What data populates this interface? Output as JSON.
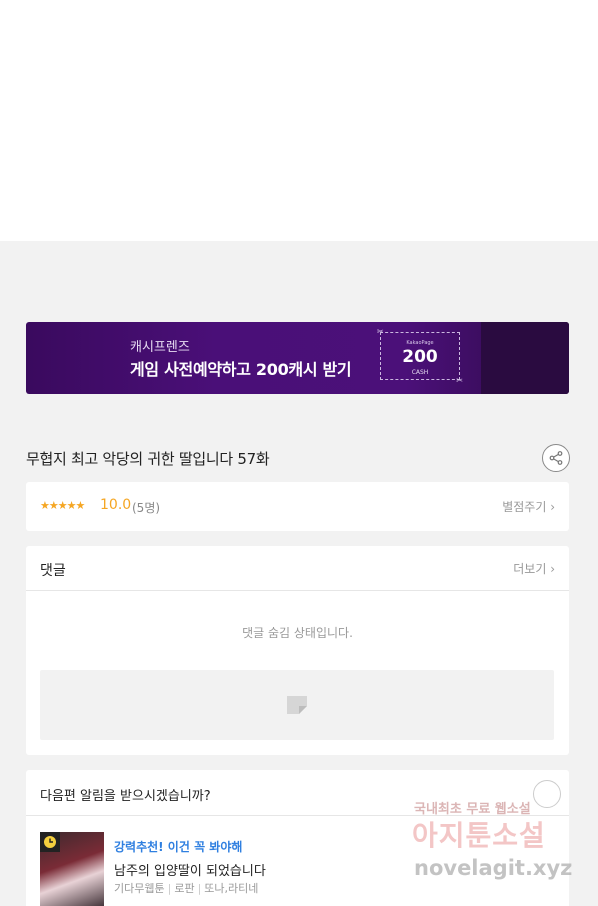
{
  "banner": {
    "subtitle": "캐시프렌즈",
    "title": "게임 사전예약하고 200캐시 받기",
    "coupon_brand": "KakaoPage",
    "coupon_amount": "200",
    "coupon_unit": "CASH"
  },
  "episode": {
    "title": "무협지 최고 악당의 귀한 딸입니다 57화"
  },
  "rating": {
    "stars": "★★★★★",
    "score": "10.0",
    "count": "(5명)",
    "rate_label": "별점주기 ›"
  },
  "comments": {
    "title": "댓글",
    "more_label": "더보기 ›",
    "hidden_message": "댓글 숨김 상태입니다."
  },
  "notify": {
    "question": "다음편 알림을 받으시겠습니까?"
  },
  "recommend": {
    "label": "강력추천! 이건 꼭 봐야해",
    "title": "남주의 입양딸이 되었습니다",
    "meta": [
      "기다무웹툰",
      "로판",
      "또나,라티네"
    ]
  },
  "watermark": {
    "line1": "국내최초 무료 웹소설",
    "line2": "아지툰소설",
    "line3": "novelagit.xyz"
  }
}
